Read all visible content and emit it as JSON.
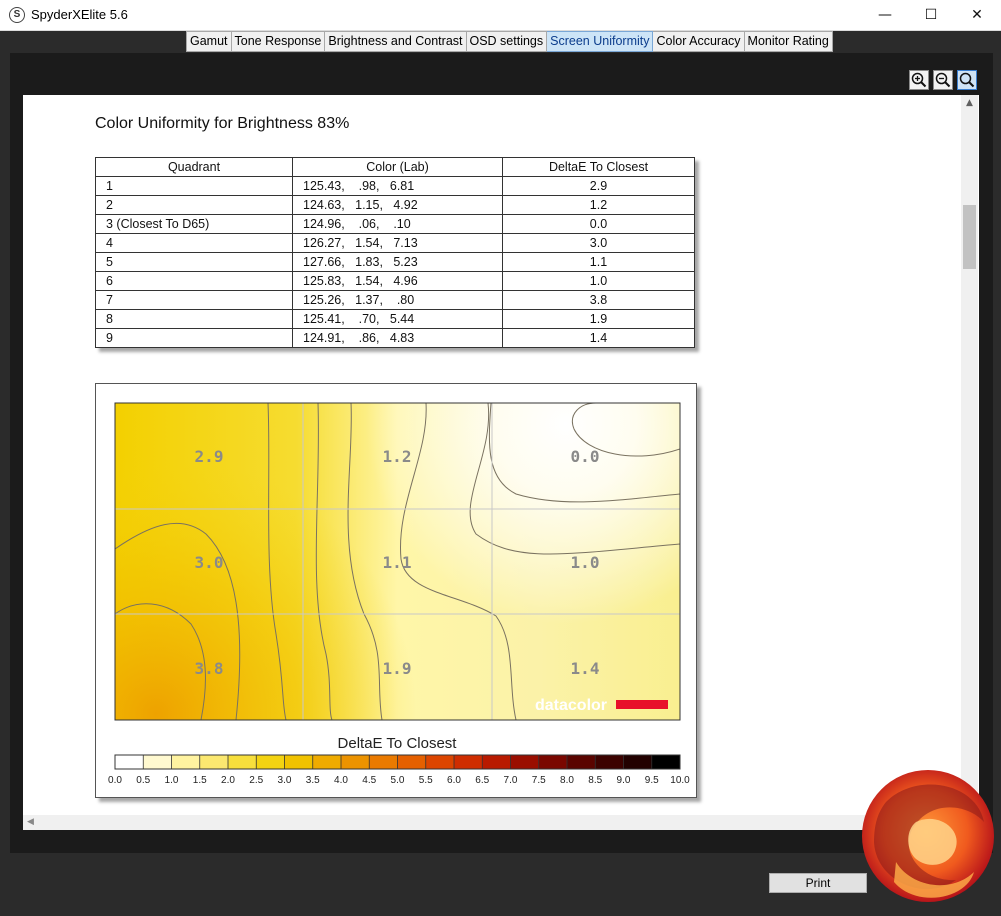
{
  "window": {
    "app_icon": "S",
    "title": "SpyderXElite 5.6",
    "minimize_icon": "minimize-icon",
    "maximize_icon": "maximize-icon",
    "close_icon": "close-icon"
  },
  "tabs": [
    {
      "label": "Gamut",
      "active": false
    },
    {
      "label": "Tone Response",
      "active": false
    },
    {
      "label": "Brightness and Contrast",
      "active": false
    },
    {
      "label": "OSD settings",
      "active": false
    },
    {
      "label": "Screen Uniformity",
      "active": true
    },
    {
      "label": "Color Accuracy",
      "active": false
    },
    {
      "label": "Monitor Rating",
      "active": false
    }
  ],
  "zoom_tools": [
    "zoom-in-icon",
    "zoom-out-icon",
    "zoom-fit-icon"
  ],
  "report": {
    "title": "Color Uniformity for Brightness 83%",
    "table": {
      "headers": [
        "Quadrant",
        "Color (Lab)",
        "DeltaE To Closest"
      ],
      "rows": [
        {
          "quadrant": "1",
          "lab": "125.43,    .98,   6.81",
          "delta": "2.9"
        },
        {
          "quadrant": "2",
          "lab": "124.63,   1.15,   4.92",
          "delta": "1.2"
        },
        {
          "quadrant": "3 (Closest To D65)",
          "lab": "124.96,    .06,    .10",
          "delta": "0.0"
        },
        {
          "quadrant": "4",
          "lab": "126.27,   1.54,   7.13",
          "delta": "3.0"
        },
        {
          "quadrant": "5",
          "lab": "127.66,   1.83,   5.23",
          "delta": "1.1"
        },
        {
          "quadrant": "6",
          "lab": "125.83,   1.54,   4.96",
          "delta": "1.0"
        },
        {
          "quadrant": "7",
          "lab": "125.26,   1.37,    .80",
          "delta": "3.8"
        },
        {
          "quadrant": "8",
          "lab": "125.41,    .70,   5.44",
          "delta": "1.9"
        },
        {
          "quadrant": "9",
          "lab": "124.91,    .86,   4.83",
          "delta": "1.4"
        }
      ]
    },
    "contour": {
      "cell_values": [
        "2.9",
        "1.2",
        "0.0",
        "3.0",
        "1.1",
        "1.0",
        "3.8",
        "1.9",
        "1.4"
      ],
      "brand": "datacolor",
      "brand_bar_color": "#e8102a",
      "legend_title": "DeltaE To Closest",
      "scale_ticks": [
        "0.0",
        "0.5",
        "1.0",
        "1.5",
        "2.0",
        "2.5",
        "3.0",
        "3.5",
        "4.0",
        "4.5",
        "5.0",
        "5.5",
        "6.0",
        "6.5",
        "7.0",
        "7.5",
        "8.0",
        "8.5",
        "9.0",
        "9.5",
        "10.0"
      ],
      "scale_colors": [
        "#ffffff",
        "#fff9d0",
        "#fff3a0",
        "#fbe870",
        "#f7df3c",
        "#f3d311",
        "#f0c200",
        "#efab00",
        "#ec9300",
        "#ea7a00",
        "#e56000",
        "#dc4500",
        "#cf2d00",
        "#b81a00",
        "#9a0e00",
        "#7a0700",
        "#5a0400",
        "#3c0200",
        "#220100",
        "#000000"
      ]
    }
  },
  "footer": {
    "print_label": "Print"
  },
  "watermark": "bit-tech-logo"
}
